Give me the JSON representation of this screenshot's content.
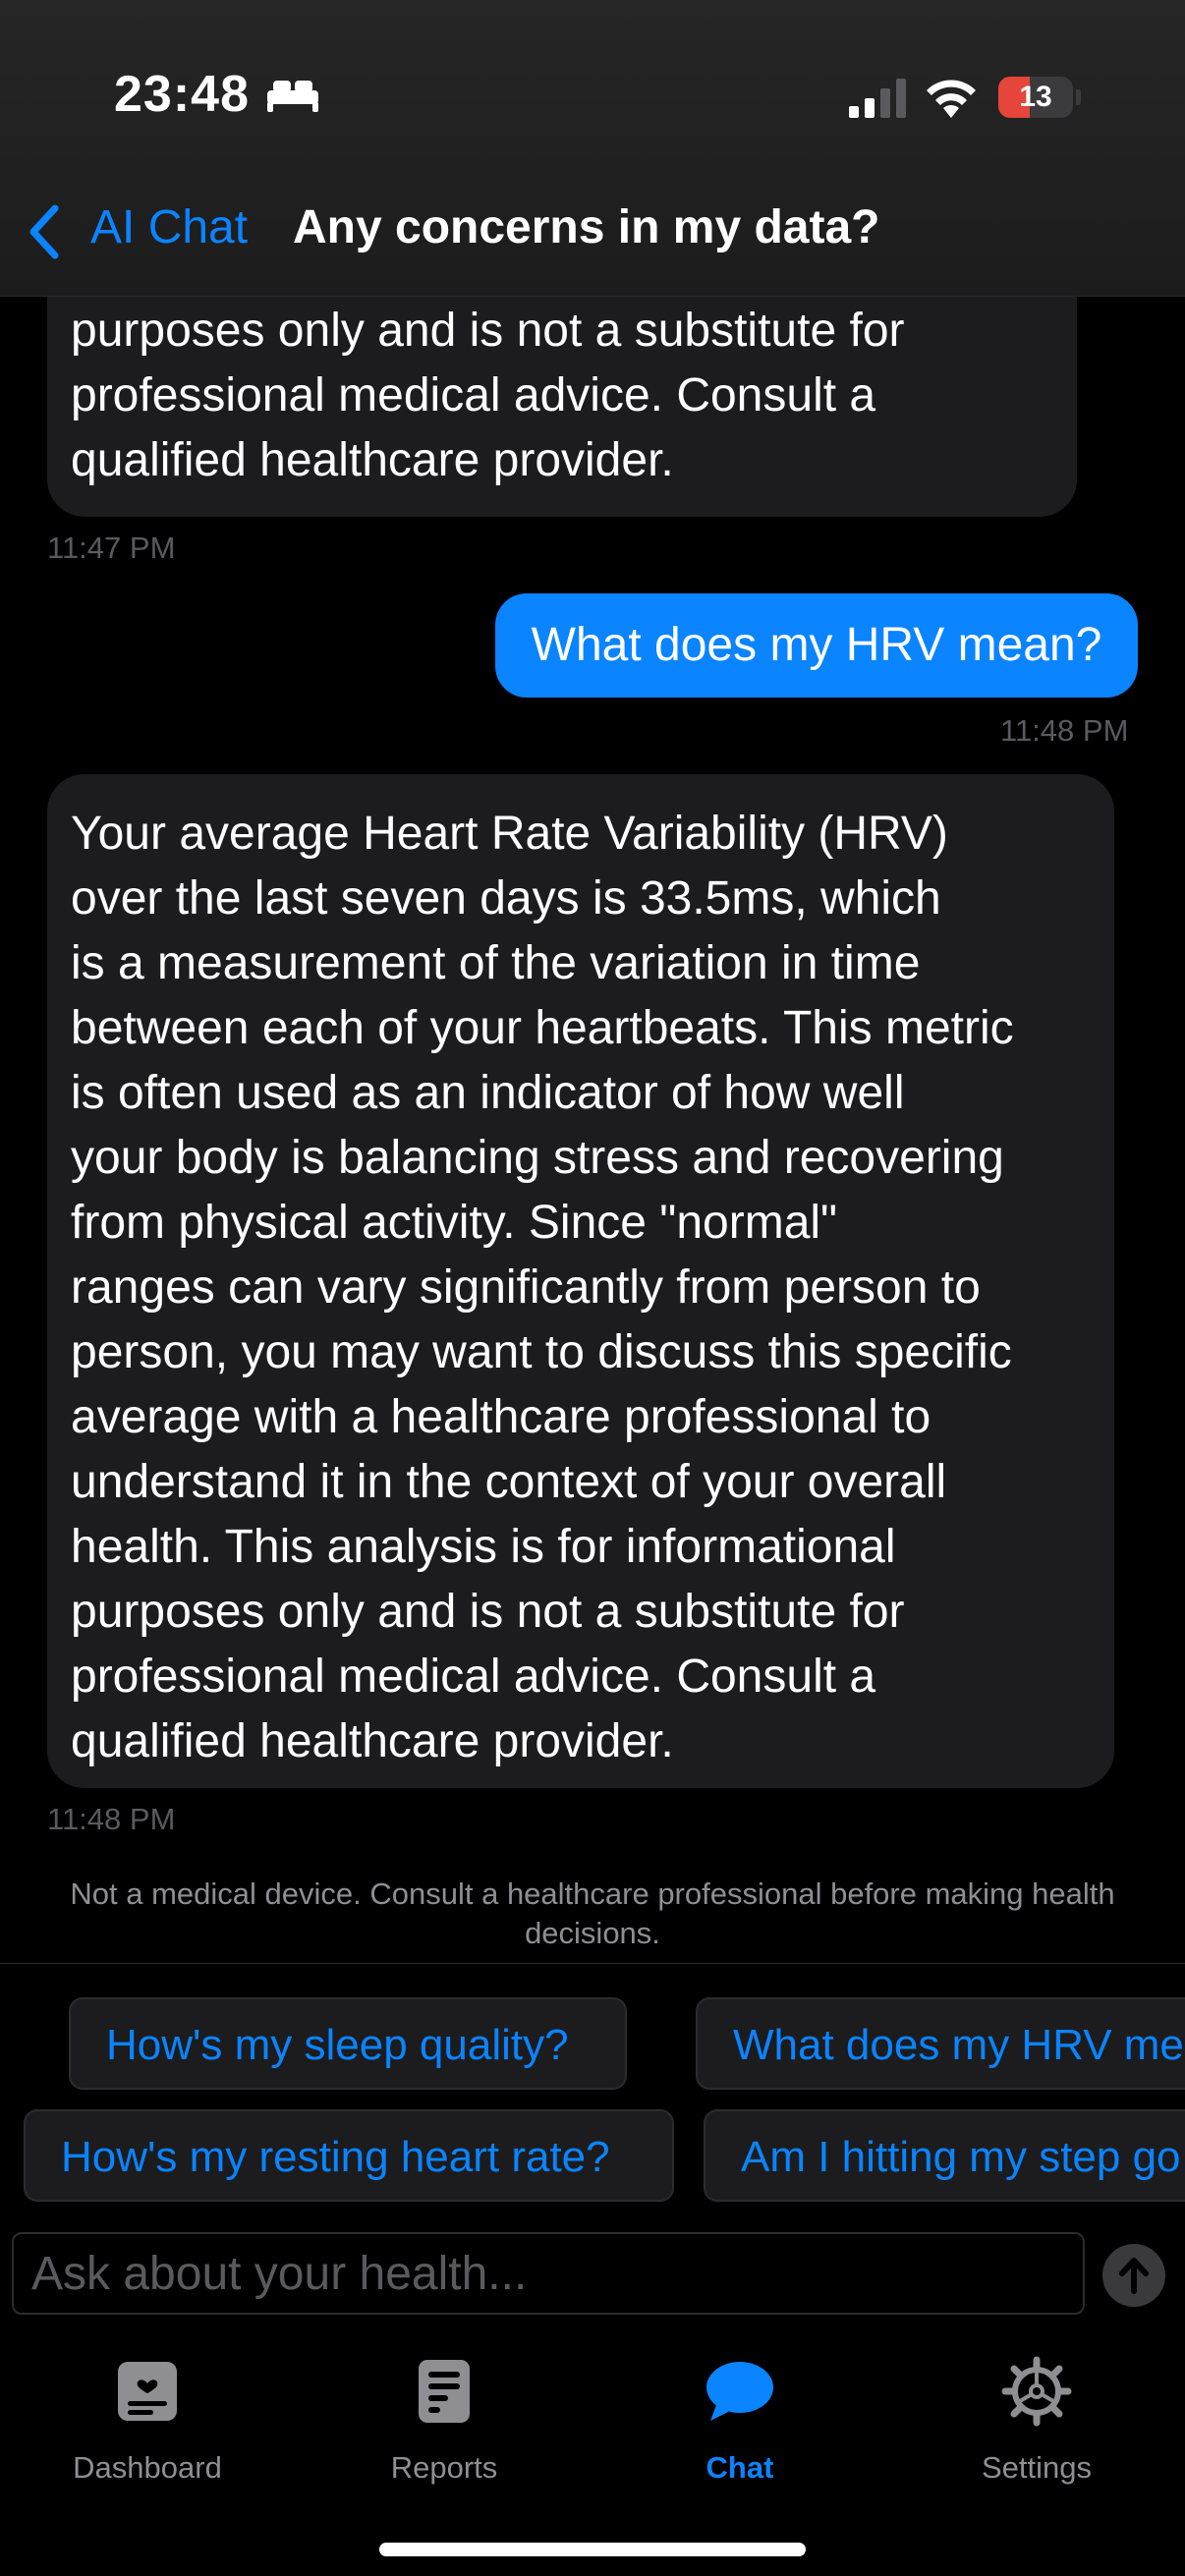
{
  "status_bar": {
    "time": "23:48",
    "battery_level": "13",
    "battery_fraction": 0.13,
    "icons": [
      "bed-icon",
      "cellular-signal-icon",
      "wifi-icon",
      "battery-icon"
    ]
  },
  "nav": {
    "back_label": "AI Chat",
    "title": "Any concerns in my data?"
  },
  "messages": [
    {
      "role": "assistant",
      "text": "purposes only and is not a substitute for\nprofessional medical advice. Consult a\nqualified healthcare provider.",
      "time": "11:47 PM"
    },
    {
      "role": "user",
      "text": "What does my HRV mean?",
      "time": "11:48 PM"
    },
    {
      "role": "assistant",
      "text": "Your average Heart Rate Variability (HRV)\nover the last seven days is 33.5ms, which\nis a measurement of the variation in time\nbetween each of your heartbeats. This metric\nis often used as an indicator of how well\nyour body is balancing stress and recovering\nfrom physical activity. Since \"normal\"\nranges can vary significantly from person to\nperson, you may want to discuss this specific\naverage with a healthcare professional to\nunderstand it in the context of your overall\nhealth. This analysis is for informational\npurposes only and is not a substitute for\nprofessional medical advice. Consult a\nqualified healthcare provider.",
      "time": "11:48 PM"
    }
  ],
  "disclaimer": "Not a medical device. Consult a healthcare professional before making health decisions.",
  "suggestions": [
    "How's my sleep quality?",
    "What does my HRV me",
    "How's my resting heart rate?",
    "Am I hitting my step go"
  ],
  "input": {
    "placeholder": "Ask about your health...",
    "value": ""
  },
  "tabs": [
    {
      "label": "Dashboard",
      "icon": "dashboard-icon",
      "active": false
    },
    {
      "label": "Reports",
      "icon": "reports-icon",
      "active": false
    },
    {
      "label": "Chat",
      "icon": "chat-bubble-icon",
      "active": true
    },
    {
      "label": "Settings",
      "icon": "gear-icon",
      "active": false
    }
  ],
  "colors": {
    "accent": "#0a84ff",
    "background": "#000000",
    "assistant_bubble": "#1c1c1e",
    "user_bubble": "#0a84ff",
    "battery_low": "#e5453a",
    "secondary_text": "#8e8e93"
  }
}
